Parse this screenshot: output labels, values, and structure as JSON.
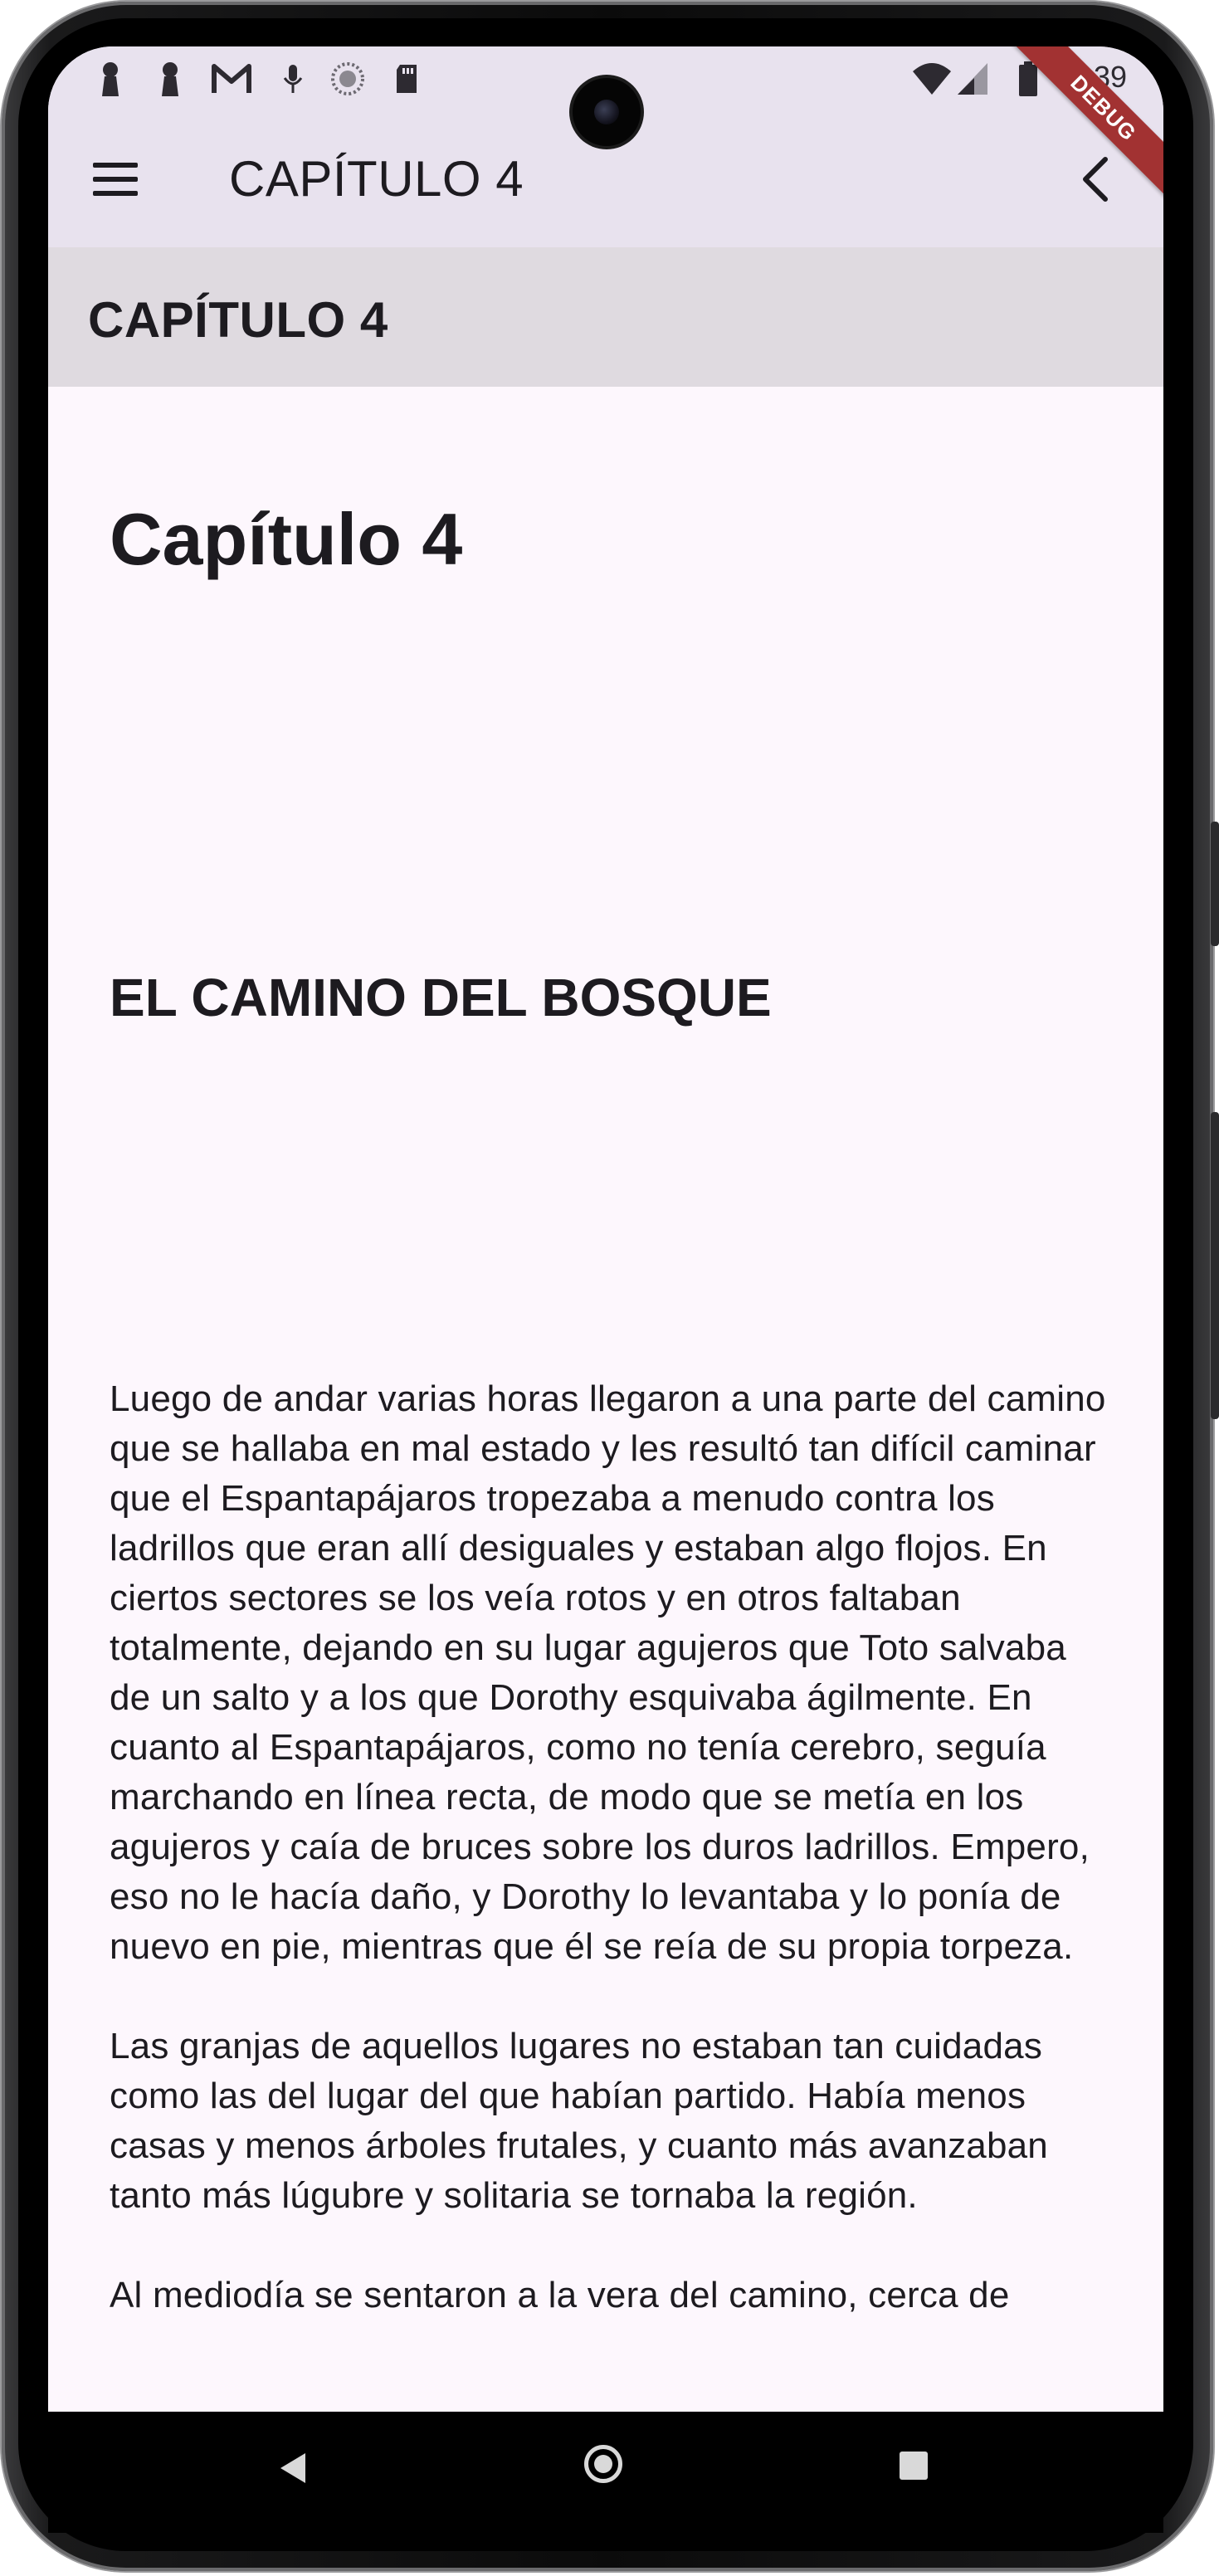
{
  "status_bar": {
    "time": "4:39",
    "left_icons": [
      "keyhole-icon",
      "keyhole-icon",
      "gmail-icon",
      "microphone-icon",
      "sync-dots-icon",
      "sd-card-icon"
    ],
    "right_icons": [
      "wifi-icon",
      "signal-icon",
      "battery-icon"
    ]
  },
  "app_bar": {
    "title": "CAPÍTULO 4",
    "debug_banner": "DEBUG",
    "background": "#e8e2ee"
  },
  "chapter_header": {
    "label": "CAPÍTULO 4",
    "background": "#dfdae0"
  },
  "content": {
    "title": "Capítulo 4",
    "subtitle": "EL CAMINO DEL BOSQUE",
    "paragraphs": [
      "Luego de andar varias horas llegaron a una parte del camino que se hallaba en mal estado y les resultó tan difícil caminar que el Espantapájaros tropezaba a menudo contra los ladrillos que eran allí desiguales y estaban algo flojos. En ciertos sectores se los veía rotos y en otros faltaban totalmente, dejando en su lugar agujeros que Toto salvaba de un salto y a los que Dorothy esquivaba ágilmente. En cuanto al Espantapájaros, como no tenía cerebro, seguía marchando en línea recta, de modo que se metía en los agujeros y caía de bruces sobre los duros ladrillos. Empero, eso no le hacía daño, y Dorothy lo levantaba y lo ponía de nuevo en pie, mientras que él se reía de su propia torpeza.",
      "Las granjas de aquellos lugares no estaban tan cuidadas como las del lugar del que habían partido. Había menos casas y menos árboles frutales, y cuanto más avanzaban tanto más lúgubre y solitaria se tornaba la región.",
      "Al mediodía se sentaron a la vera del camino, cerca de"
    ],
    "background": "#fdf7fd"
  },
  "nav_bar": {
    "buttons": [
      "back",
      "home",
      "recents"
    ]
  }
}
